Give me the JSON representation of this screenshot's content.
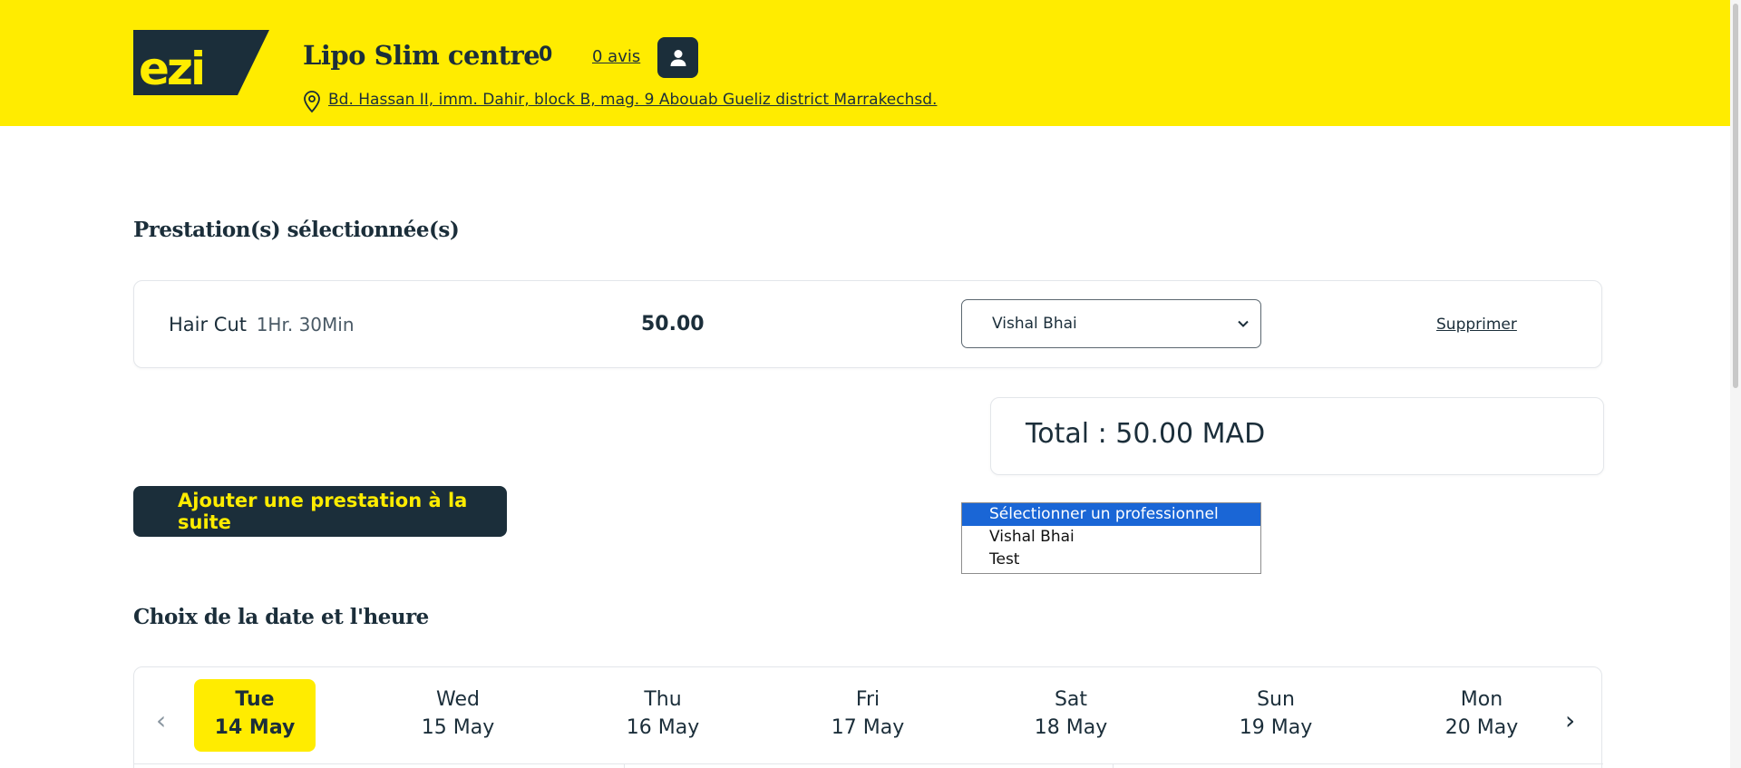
{
  "header": {
    "logo_text": "ezi",
    "shop_name": "Lipo Slim centre",
    "rating": "0",
    "reviews_link": "0 avis",
    "address": "Bd. Hassan II, imm. Dahir, block B, mag. 9 Abouab Gueliz district Marrakechsd."
  },
  "icons": {
    "user": "user-icon",
    "pin": "map-pin-icon",
    "select_chevron": "chevron-down-icon",
    "cal_prev": "chevron-left-icon",
    "cal_next": "chevron-right-icon"
  },
  "selected_services": {
    "title": "Prestation(s) sélectionnée(s)",
    "items": [
      {
        "name": "Hair Cut",
        "duration": "1Hr. 30Min",
        "price": "50.00",
        "professional": "Vishal Bhai",
        "delete_label": "Supprimer"
      }
    ]
  },
  "total": {
    "text": "Total : 50.00 MAD"
  },
  "add_button": {
    "label": "Ajouter une prestation à la suite"
  },
  "professional_dropdown": {
    "options": [
      "Sélectionner un professionnel",
      "Vishal Bhai",
      "Test"
    ],
    "highlighted_index": 0
  },
  "schedule": {
    "title": "Choix de la date et l'heure",
    "prev_arrow": "‹",
    "next_arrow": "›",
    "days": [
      {
        "name": "Tue",
        "date": "14 May",
        "active": true
      },
      {
        "name": "Wed",
        "date": "15 May",
        "active": false
      },
      {
        "name": "Thu",
        "date": "16 May",
        "active": false
      },
      {
        "name": "Fri",
        "date": "17 May",
        "active": false
      },
      {
        "name": "Sat",
        "date": "18 May",
        "active": false
      },
      {
        "name": "Sun",
        "date": "19 May",
        "active": false
      },
      {
        "name": "Mon",
        "date": "20 May",
        "active": false
      }
    ]
  },
  "colors": {
    "brand_yellow": "#ffec00",
    "dark_navy": "#1b2e3a",
    "selection_blue": "#1a66d6"
  }
}
